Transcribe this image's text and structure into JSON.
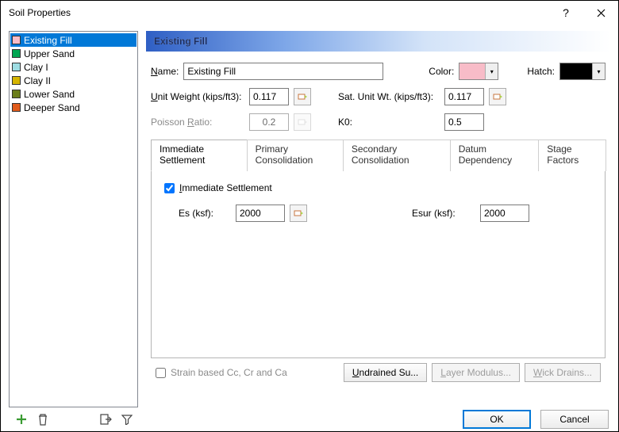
{
  "window": {
    "title": "Soil Properties"
  },
  "sidebar": {
    "items": [
      {
        "label": "Existing Fill",
        "color": "#f8bcc8",
        "selected": true
      },
      {
        "label": "Upper Sand",
        "color": "#00a651",
        "selected": false
      },
      {
        "label": "Clay I",
        "color": "#9edde3",
        "selected": false
      },
      {
        "label": "Clay II",
        "color": "#d6b500",
        "selected": false
      },
      {
        "label": "Lower Sand",
        "color": "#6b7d1a",
        "selected": false
      },
      {
        "label": "Deeper Sand",
        "color": "#e15b1b",
        "selected": false
      }
    ]
  },
  "header": {
    "title": "Existing Fill"
  },
  "form": {
    "name_lbl_pre": "N",
    "name_lbl_post": "ame:",
    "name_val": "Existing Fill",
    "color_lbl": "Color:",
    "color_val": "#f8bcc8",
    "hatch_lbl": "Hatch:",
    "hatch_val": "#000000",
    "uw_lbl_pre": "U",
    "uw_lbl_post": "nit Weight (kips/ft3):",
    "uw_val": "0.117",
    "suw_lbl": "Sat. Unit Wt. (kips/ft3):",
    "suw_val": "0.117",
    "pr_lbl_pre": "Poisson ",
    "pr_lbl_u": "R",
    "pr_lbl_post": "atio:",
    "pr_val": "0.2",
    "k0_lbl": "K0:",
    "k0_val": "0.5"
  },
  "tabs": {
    "t0": "Immediate Settlement",
    "t1": "Primary Consolidation",
    "t2": "Secondary Consolidation",
    "t3": "Datum Dependency",
    "t4": "Stage Factors"
  },
  "imm": {
    "chk_pre": "I",
    "chk_post": "mmediate Settlement",
    "es_lbl": "Es (ksf):",
    "es_val": "2000",
    "esur_lbl": "Esur (ksf):",
    "esur_val": "2000"
  },
  "bottom": {
    "strain_lbl": "Strain based Cc, Cr and Ca",
    "undrained": "Undrained Su...",
    "layermod": "Layer Modulus...",
    "wick": "Wick Drains..."
  },
  "footer": {
    "ok": "OK",
    "cancel": "Cancel"
  }
}
